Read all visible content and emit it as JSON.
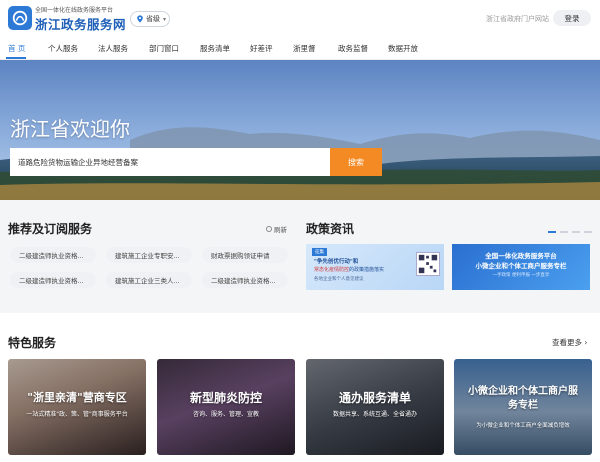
{
  "header": {
    "brand_sub": "全国一体化在线政务服务平台",
    "brand_title": "浙江政务服务网",
    "region": "省级",
    "portal_link": "浙江省政府门户网站",
    "login": "登录"
  },
  "nav": {
    "items": [
      "首 页",
      "个人服务",
      "法人服务",
      "部门窗口",
      "服务清单",
      "好差评",
      "浙里督",
      "政务监督",
      "数据开放"
    ]
  },
  "hero": {
    "title": "浙江省欢迎你",
    "search_value": "道路危险货物运输企业异地经营备案",
    "search_button": "搜索"
  },
  "recommend": {
    "title": "推荐及订阅服务",
    "refresh": "刷新",
    "pills": [
      "二级建造师执业资格...",
      "建筑施工企业专职安...",
      "财政票据购领证申请",
      "二级建造师执业资格...",
      "建筑施工企业三类人...",
      "二级建造师执业资格..."
    ]
  },
  "policy": {
    "title": "政策资讯",
    "card1": {
      "tag": "征集",
      "line1": "\"争先创优行动\"和",
      "line2_hl": "常态化疫情防控",
      "line2_rest": "的政策措施落实",
      "line3": "各地企业和个人意见建议"
    },
    "card2": {
      "line1": "全国一体化政务服务平台",
      "line2": "小微企业和个体工商户服务专栏",
      "line3": "一手政策 便利申报 一步直享"
    }
  },
  "featured": {
    "title": "特色服务",
    "more": "查看更多",
    "items": [
      {
        "title": "\"浙里亲清\"营商专区",
        "sub": "一站式精准\"政、策、管\"商事服务平台"
      },
      {
        "title": "新型肺炎防控",
        "sub": "咨询、服务、管理、宣教"
      },
      {
        "title": "通办服务清单",
        "sub": "数据共享、系统互通、全省通办"
      },
      {
        "title": "小微企业和个体工商户服务专栏",
        "sub": "为小微企业和个体工商户全面减负增效"
      }
    ]
  },
  "colors": {
    "brand_blue": "#2d7ad6",
    "search_orange": "#f48a23"
  }
}
